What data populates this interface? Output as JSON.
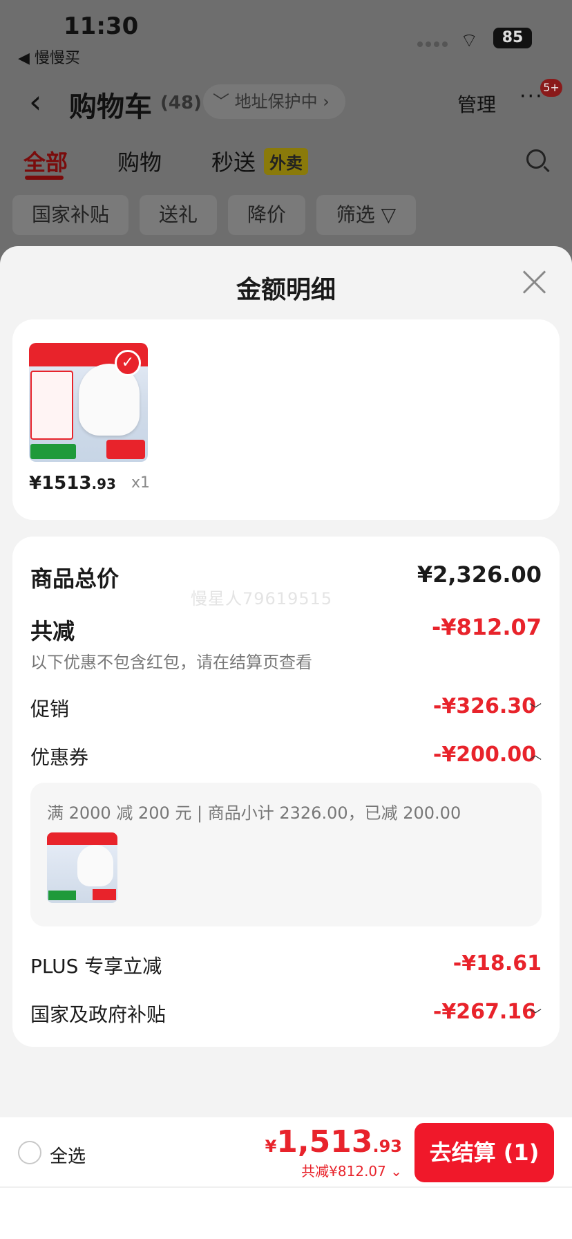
{
  "status_bar": {
    "time": "11:30",
    "back_app": "◀ 慢慢买",
    "battery": "85"
  },
  "header": {
    "title": "购物车",
    "count": "(48)",
    "address_pill": "﹀ 地址保护中 ›",
    "manage": "管理",
    "more": "···",
    "badge": "5+"
  },
  "tabs": [
    {
      "label": "全部",
      "active": true
    },
    {
      "label": "购物",
      "active": false
    },
    {
      "label": "秒送",
      "active": false
    }
  ],
  "takeout_tag": "外卖",
  "chips": [
    "国家补贴",
    "送礼",
    "降价",
    "筛选 ▽"
  ],
  "sheet": {
    "title": "金额明细",
    "item": {
      "price_int": "¥1513",
      "price_dec": ".93",
      "qty": "x1",
      "check": "✓"
    },
    "watermark": "慢星人79619515",
    "rows": {
      "goods_total_label": "商品总价",
      "goods_total_value": "¥2,326.00",
      "reduce_label": "共减",
      "reduce_value": "-¥812.07",
      "reduce_note": "以下优惠不包含红包，请在结算页查看",
      "promo_label": "促销",
      "promo_value": "-¥326.30",
      "coupon_label": "优惠券",
      "coupon_value": "-¥200.00",
      "coupon_detail": "满 2000 减 200 元 | 商品小计 2326.00，已减 200.00",
      "plus_label": "PLUS 专享立减",
      "plus_value": "-¥18.61",
      "subsidy_label": "国家及政府补贴",
      "subsidy_value": "-¥267.16"
    }
  },
  "bottom": {
    "select_all": "全选",
    "total_yen": "¥",
    "total_int": "1,513",
    "total_dec": ".93",
    "saved": "共减¥812.07 ⌄",
    "checkout": "去结算 (1)"
  },
  "colors": {
    "accent_red": "#e8232b",
    "checkout_red": "#f0182a"
  }
}
